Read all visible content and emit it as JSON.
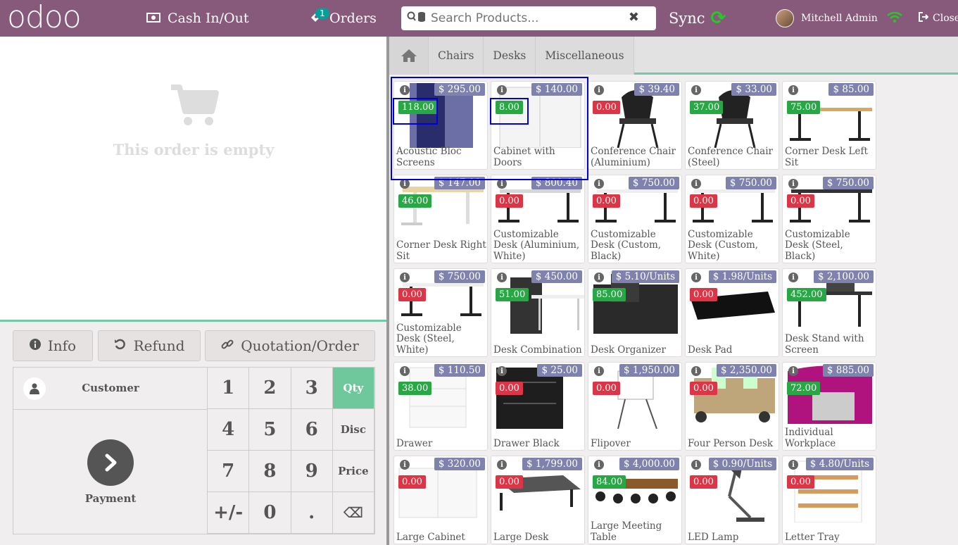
{
  "header": {
    "logo": "odoo",
    "cash_label": "Cash In/Out",
    "orders_label": "Orders",
    "orders_count": "1",
    "search_placeholder": "Search Products...",
    "sync_label": "Sync",
    "user_name": "Mitchell Admin",
    "close_label": "Close"
  },
  "order": {
    "empty_text": "This order is empty"
  },
  "controls": {
    "info_label": "Info",
    "refund_label": "Refund",
    "quotation_label": "Quotation/Order",
    "customer_label": "Customer",
    "payment_label": "Payment"
  },
  "numpad": {
    "keys": [
      "1",
      "2",
      "3",
      "Qty",
      "4",
      "5",
      "6",
      "Disc",
      "7",
      "8",
      "9",
      "Price",
      "+/-",
      "0",
      ".",
      "⌫"
    ],
    "active_mode": "Qty"
  },
  "categories": [
    "Chairs",
    "Desks",
    "Miscellaneous"
  ],
  "products": [
    {
      "name": "Acoustic Bloc Screens",
      "price": "$ 295.00",
      "qty": "118.00",
      "stock": "pos"
    },
    {
      "name": "Cabinet with Doors",
      "price": "$ 140.00",
      "qty": "8.00",
      "stock": "pos"
    },
    {
      "name": "Conference Chair (Aluminium)",
      "price": "$ 39.40",
      "qty": "0.00",
      "stock": "neg"
    },
    {
      "name": "Conference Chair (Steel)",
      "price": "$ 33.00",
      "qty": "37.00",
      "stock": "pos"
    },
    {
      "name": "Corner Desk Left Sit",
      "price": "$ 85.00",
      "qty": "75.00",
      "stock": "pos"
    },
    {
      "name": "Corner Desk Right Sit",
      "price": "$ 147.00",
      "qty": "46.00",
      "stock": "pos"
    },
    {
      "name": "Customizable Desk (Aluminium, White)",
      "price": "$ 800.40",
      "qty": "0.00",
      "stock": "neg"
    },
    {
      "name": "Customizable Desk (Custom, Black)",
      "price": "$ 750.00",
      "qty": "0.00",
      "stock": "neg"
    },
    {
      "name": "Customizable Desk (Custom, White)",
      "price": "$ 750.00",
      "qty": "0.00",
      "stock": "neg"
    },
    {
      "name": "Customizable Desk (Steel, Black)",
      "price": "$ 750.00",
      "qty": "0.00",
      "stock": "neg"
    },
    {
      "name": "Customizable Desk (Steel, White)",
      "price": "$ 750.00",
      "qty": "0.00",
      "stock": "neg"
    },
    {
      "name": "Desk Combination",
      "price": "$ 450.00",
      "qty": "51.00",
      "stock": "pos"
    },
    {
      "name": "Desk Organizer",
      "price": "$ 5.10/Units",
      "qty": "85.00",
      "stock": "pos"
    },
    {
      "name": "Desk Pad",
      "price": "$ 1.98/Units",
      "qty": "0.00",
      "stock": "neg"
    },
    {
      "name": "Desk Stand with Screen",
      "price": "$ 2,100.00",
      "qty": "452.00",
      "stock": "pos"
    },
    {
      "name": "Drawer",
      "price": "$ 110.50",
      "qty": "38.00",
      "stock": "pos"
    },
    {
      "name": "Drawer Black",
      "price": "$ 25.00",
      "qty": "0.00",
      "stock": "neg"
    },
    {
      "name": "Flipover",
      "price": "$ 1,950.00",
      "qty": "0.00",
      "stock": "neg"
    },
    {
      "name": "Four Person Desk",
      "price": "$ 2,350.00",
      "qty": "0.00",
      "stock": "neg"
    },
    {
      "name": "Individual Workplace",
      "price": "$ 885.00",
      "qty": "72.00",
      "stock": "pos"
    },
    {
      "name": "Large Cabinet",
      "price": "$ 320.00",
      "qty": "0.00",
      "stock": "neg"
    },
    {
      "name": "Large Desk",
      "price": "$ 1,799.00",
      "qty": "0.00",
      "stock": "neg"
    },
    {
      "name": "Large Meeting Table",
      "price": "$ 4,000.00",
      "qty": "84.00",
      "stock": "pos"
    },
    {
      "name": "LED Lamp",
      "price": "$ 0.90/Units",
      "qty": "0.00",
      "stock": "neg"
    },
    {
      "name": "Letter Tray",
      "price": "$ 4.80/Units",
      "qty": "0.00",
      "stock": "neg"
    }
  ]
}
